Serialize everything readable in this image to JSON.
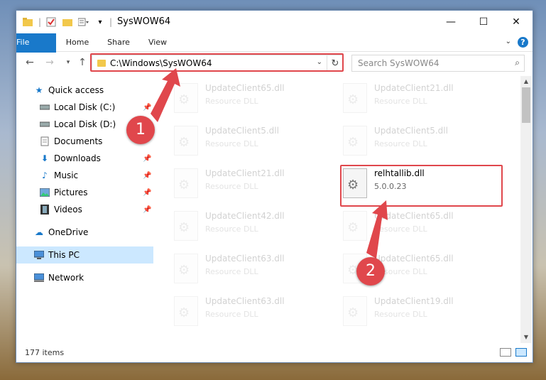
{
  "window": {
    "title": "SysWOW64",
    "minimize": "—",
    "maximize": "☐",
    "close": "✕"
  },
  "ribbon": {
    "tabs": [
      "File",
      "Home",
      "Share",
      "View"
    ],
    "help": "?"
  },
  "nav": {
    "address": "C:\\Windows\\SysWOW64",
    "search_placeholder": "Search SysWOW64"
  },
  "sidebar": {
    "items": [
      {
        "label": "Quick access",
        "icon": "star-icon"
      },
      {
        "label": "Local Disk (C:)",
        "icon": "drive-icon"
      },
      {
        "label": "Local Disk (D:)",
        "icon": "drive-icon"
      },
      {
        "label": "Documents",
        "icon": "documents-icon"
      },
      {
        "label": "Downloads",
        "icon": "download-icon"
      },
      {
        "label": "Music",
        "icon": "music-icon"
      },
      {
        "label": "Pictures",
        "icon": "pictures-icon"
      },
      {
        "label": "Videos",
        "icon": "videos-icon"
      },
      {
        "label": "OneDrive",
        "icon": "cloud-icon"
      },
      {
        "label": "This PC",
        "icon": "computer-icon"
      },
      {
        "label": "Network",
        "icon": "network-icon"
      }
    ]
  },
  "files": {
    "left": [
      {
        "name": "UpdateClient65.dll",
        "sub": "Resource DLL"
      },
      {
        "name": "UpdateClient5.dll",
        "sub": "Resource DLL"
      },
      {
        "name": "UpdateClient21.dll",
        "sub": "Resource DLL"
      },
      {
        "name": "UpdateClient42.dll",
        "sub": "Resource DLL"
      },
      {
        "name": "UpdateClient63.dll",
        "sub": "Resource DLL"
      },
      {
        "name": "UpdateClient63.dll",
        "sub": "Resource DLL"
      }
    ],
    "right": [
      {
        "name": "UpdateClient21.dll",
        "sub": "Resource DLL"
      },
      {
        "name": "UpdateClient5.dll",
        "sub": "Resource DLL"
      },
      {
        "name": "relhtallib.dll",
        "sub": "5.0.0.23"
      },
      {
        "name": "UpdateClient65.dll",
        "sub": "Resource DLL"
      },
      {
        "name": "UpdateClient65.dll",
        "sub": "Resource DLL"
      },
      {
        "name": "UpdateClient19.dll",
        "sub": "Resource DLL"
      }
    ]
  },
  "status": {
    "count": "177 items"
  },
  "annotations": {
    "step1": "1",
    "step2": "2",
    "color": "#e0474c"
  }
}
